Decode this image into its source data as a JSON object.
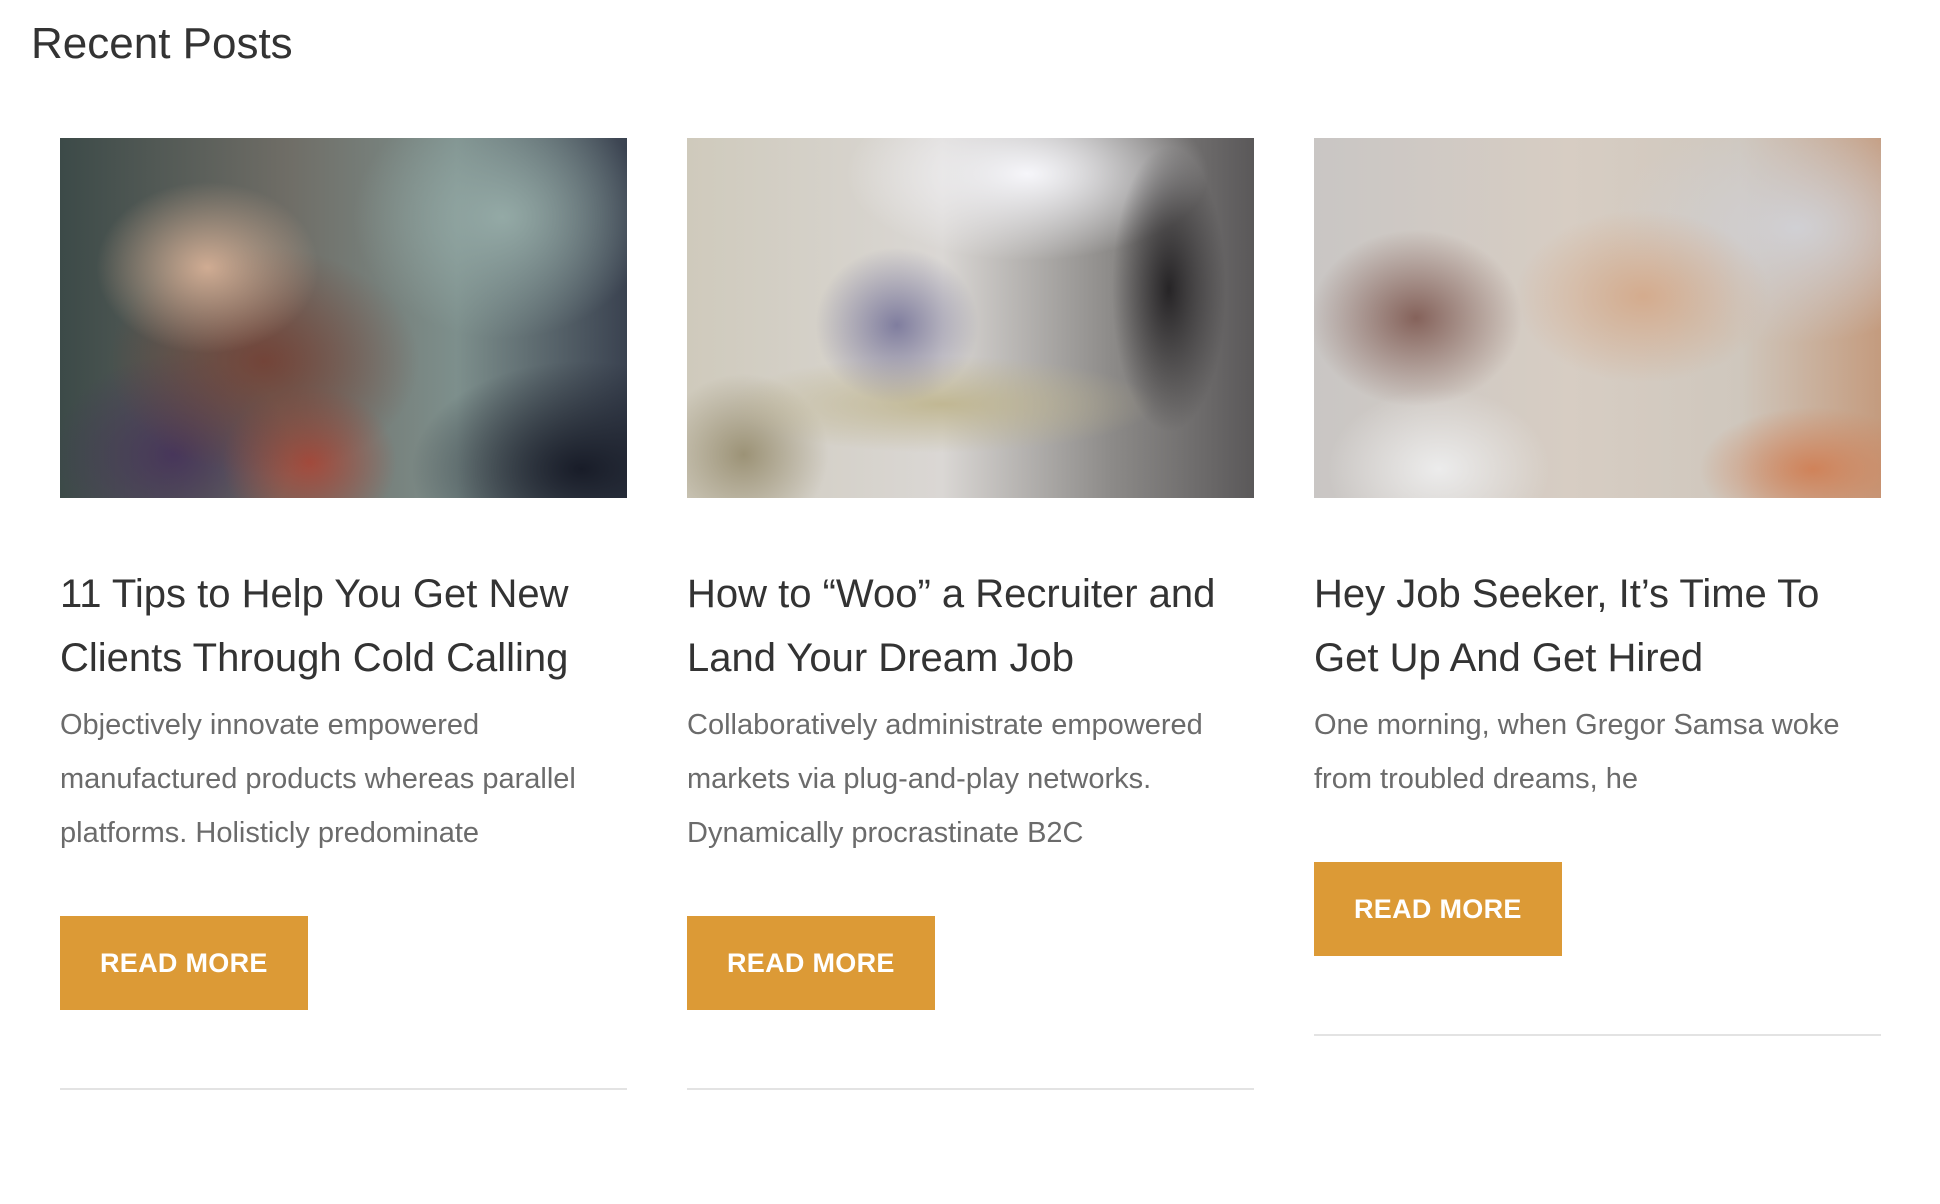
{
  "section": {
    "heading": "Recent Posts"
  },
  "posts": [
    {
      "title": "11 Tips to Help You Get New Clients Through Cold Calling",
      "excerpt": "Objectively innovate empowered manufactured products whereas parallel platforms. Holisticly predominate",
      "button_label": "READ MORE"
    },
    {
      "title": "How to “Woo” a Recruiter and Land Your Dream Job",
      "excerpt": "Collaboratively administrate empowered markets via plug-and-play networks. Dynamically procrastinate B2C",
      "button_label": "READ MORE"
    },
    {
      "title": "Hey Job Seeker, It’s Time To Get Up And Get Hired",
      "excerpt": "One morning, when Gregor Samsa woke from troubled dreams, he",
      "button_label": "READ MORE"
    }
  ],
  "colors": {
    "accent": "#dc9a36",
    "heading_text": "#333333",
    "body_text": "#6b6b6b",
    "divider": "#e3e3e3"
  }
}
